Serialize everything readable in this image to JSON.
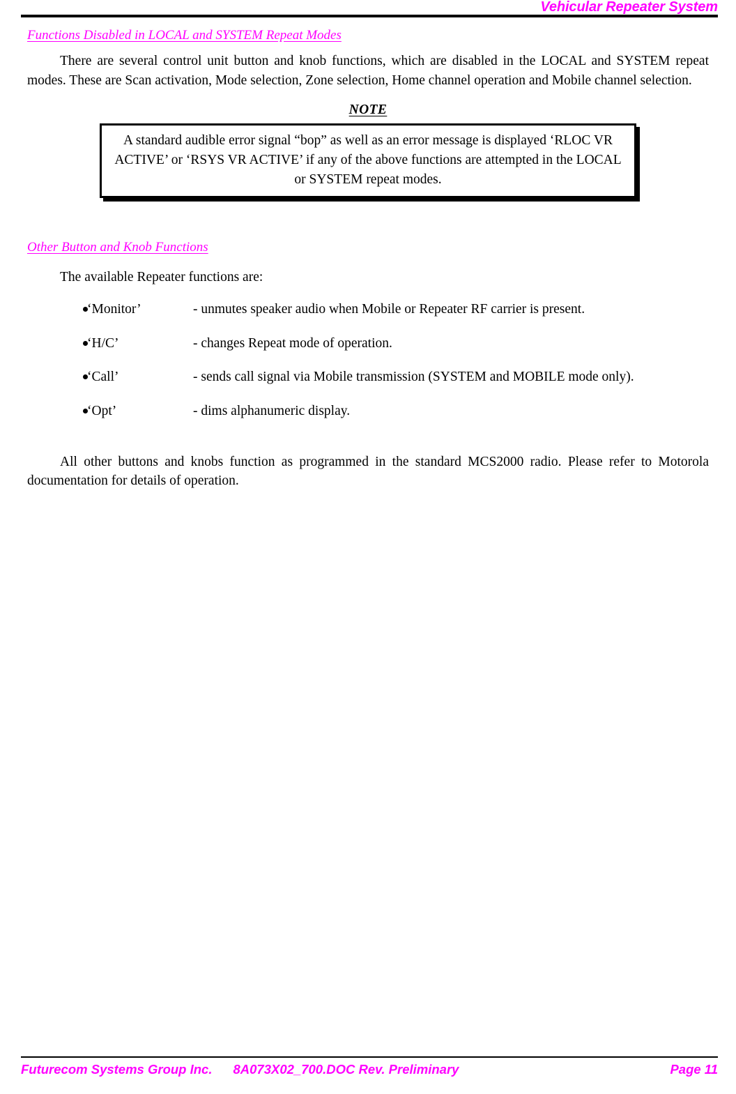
{
  "header": {
    "title": "Vehicular Repeater System"
  },
  "sections": [
    {
      "heading": "Functions Disabled in LOCAL and SYSTEM Repeat Modes",
      "paragraph": "There are several control unit button and knob functions, which are disabled in the LOCAL and SYSTEM repeat modes.  These are Scan activation, Mode selection, Zone selection, Home channel operation and Mobile channel selection."
    },
    {
      "heading": "Other Button and Knob Functions",
      "paragraph": "The available Repeater functions are:"
    }
  ],
  "note": {
    "label": "NOTE",
    "text": "A standard audible error signal “bop” as well as an error message is displayed     ‘RLOC VR ACTIVE’ or ‘RSYS VR ACTIVE’ if any of the above functions are attempted in the LOCAL or SYSTEM repeat modes."
  },
  "functions": [
    {
      "name": "‘Monitor’",
      "description": "- unmutes speaker audio when Mobile or Repeater RF carrier is present."
    },
    {
      "name": "‘H/C’",
      "description": "- changes Repeat mode of operation."
    },
    {
      "name": "‘Call’",
      "description": "- sends call signal via Mobile transmission (SYSTEM and MOBILE mode only)."
    },
    {
      "name": "‘Opt’",
      "description": "- dims alphanumeric display."
    }
  ],
  "closing_paragraph": "All other buttons and knobs function as programmed in the standard MCS2000 radio. Please refer to Motorola documentation for details of operation.",
  "footer": {
    "company": "Futurecom Systems Group Inc.",
    "document": "8A073X02_700.DOC Rev. Preliminary",
    "page": "Page 11"
  },
  "colors": {
    "accent": "#FF00FF",
    "text": "#000000",
    "background": "#FFFFFF"
  }
}
